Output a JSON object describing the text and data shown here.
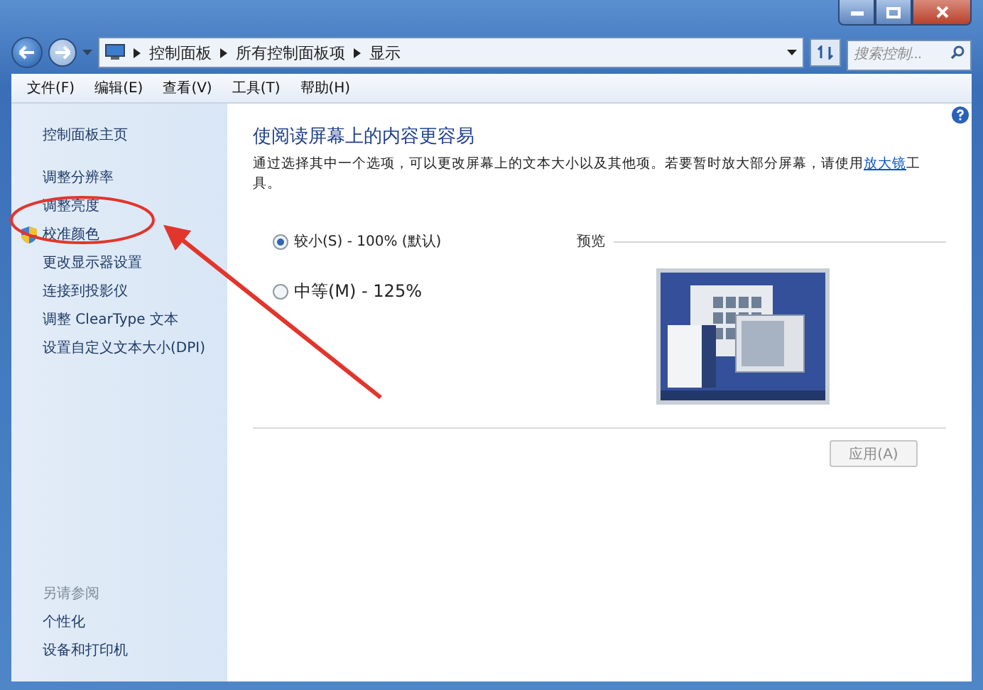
{
  "window": {
    "controls": [
      {
        "kind": "minimize"
      },
      {
        "kind": "maximize"
      },
      {
        "kind": "close"
      }
    ]
  },
  "address_bar": {
    "crumbs": [
      "控制面板",
      "所有控制面板项",
      "显示"
    ]
  },
  "search": {
    "placeholder": "搜索控制..."
  },
  "menu": [
    "文件(F)",
    "编辑(E)",
    "查看(V)",
    "工具(T)",
    "帮助(H)"
  ],
  "sidebar": {
    "home": "控制面板主页",
    "items": [
      {
        "label": "调整分辨率",
        "shield": false
      },
      {
        "label": "调整亮度",
        "shield": false
      },
      {
        "label": "校准颜色",
        "shield": true
      },
      {
        "label": "更改显示器设置",
        "shield": false
      },
      {
        "label": "连接到投影仪",
        "shield": false
      },
      {
        "label": "调整 ClearType 文本",
        "shield": false
      },
      {
        "label": "设置自定义文本大小(DPI)",
        "shield": false
      }
    ],
    "see_also_title": "另请参阅",
    "see_also": [
      "个性化",
      "设备和打印机"
    ]
  },
  "content": {
    "title": "使阅读屏幕上的内容更容易",
    "description": "通过选择其中一个选项，可以更改屏幕上的文本大小以及其他项。若要暂时放大部分屏幕，请使用",
    "link": "放大镜",
    "description_end": "工具。",
    "options": [
      {
        "label": "较小(S) - 100% (默认)",
        "selected": true,
        "large": false
      },
      {
        "label": "中等(M) - 125%",
        "selected": false,
        "large": true
      }
    ],
    "preview_label": "预览",
    "apply_button": {
      "label": "应用(A)",
      "disabled": true
    }
  }
}
